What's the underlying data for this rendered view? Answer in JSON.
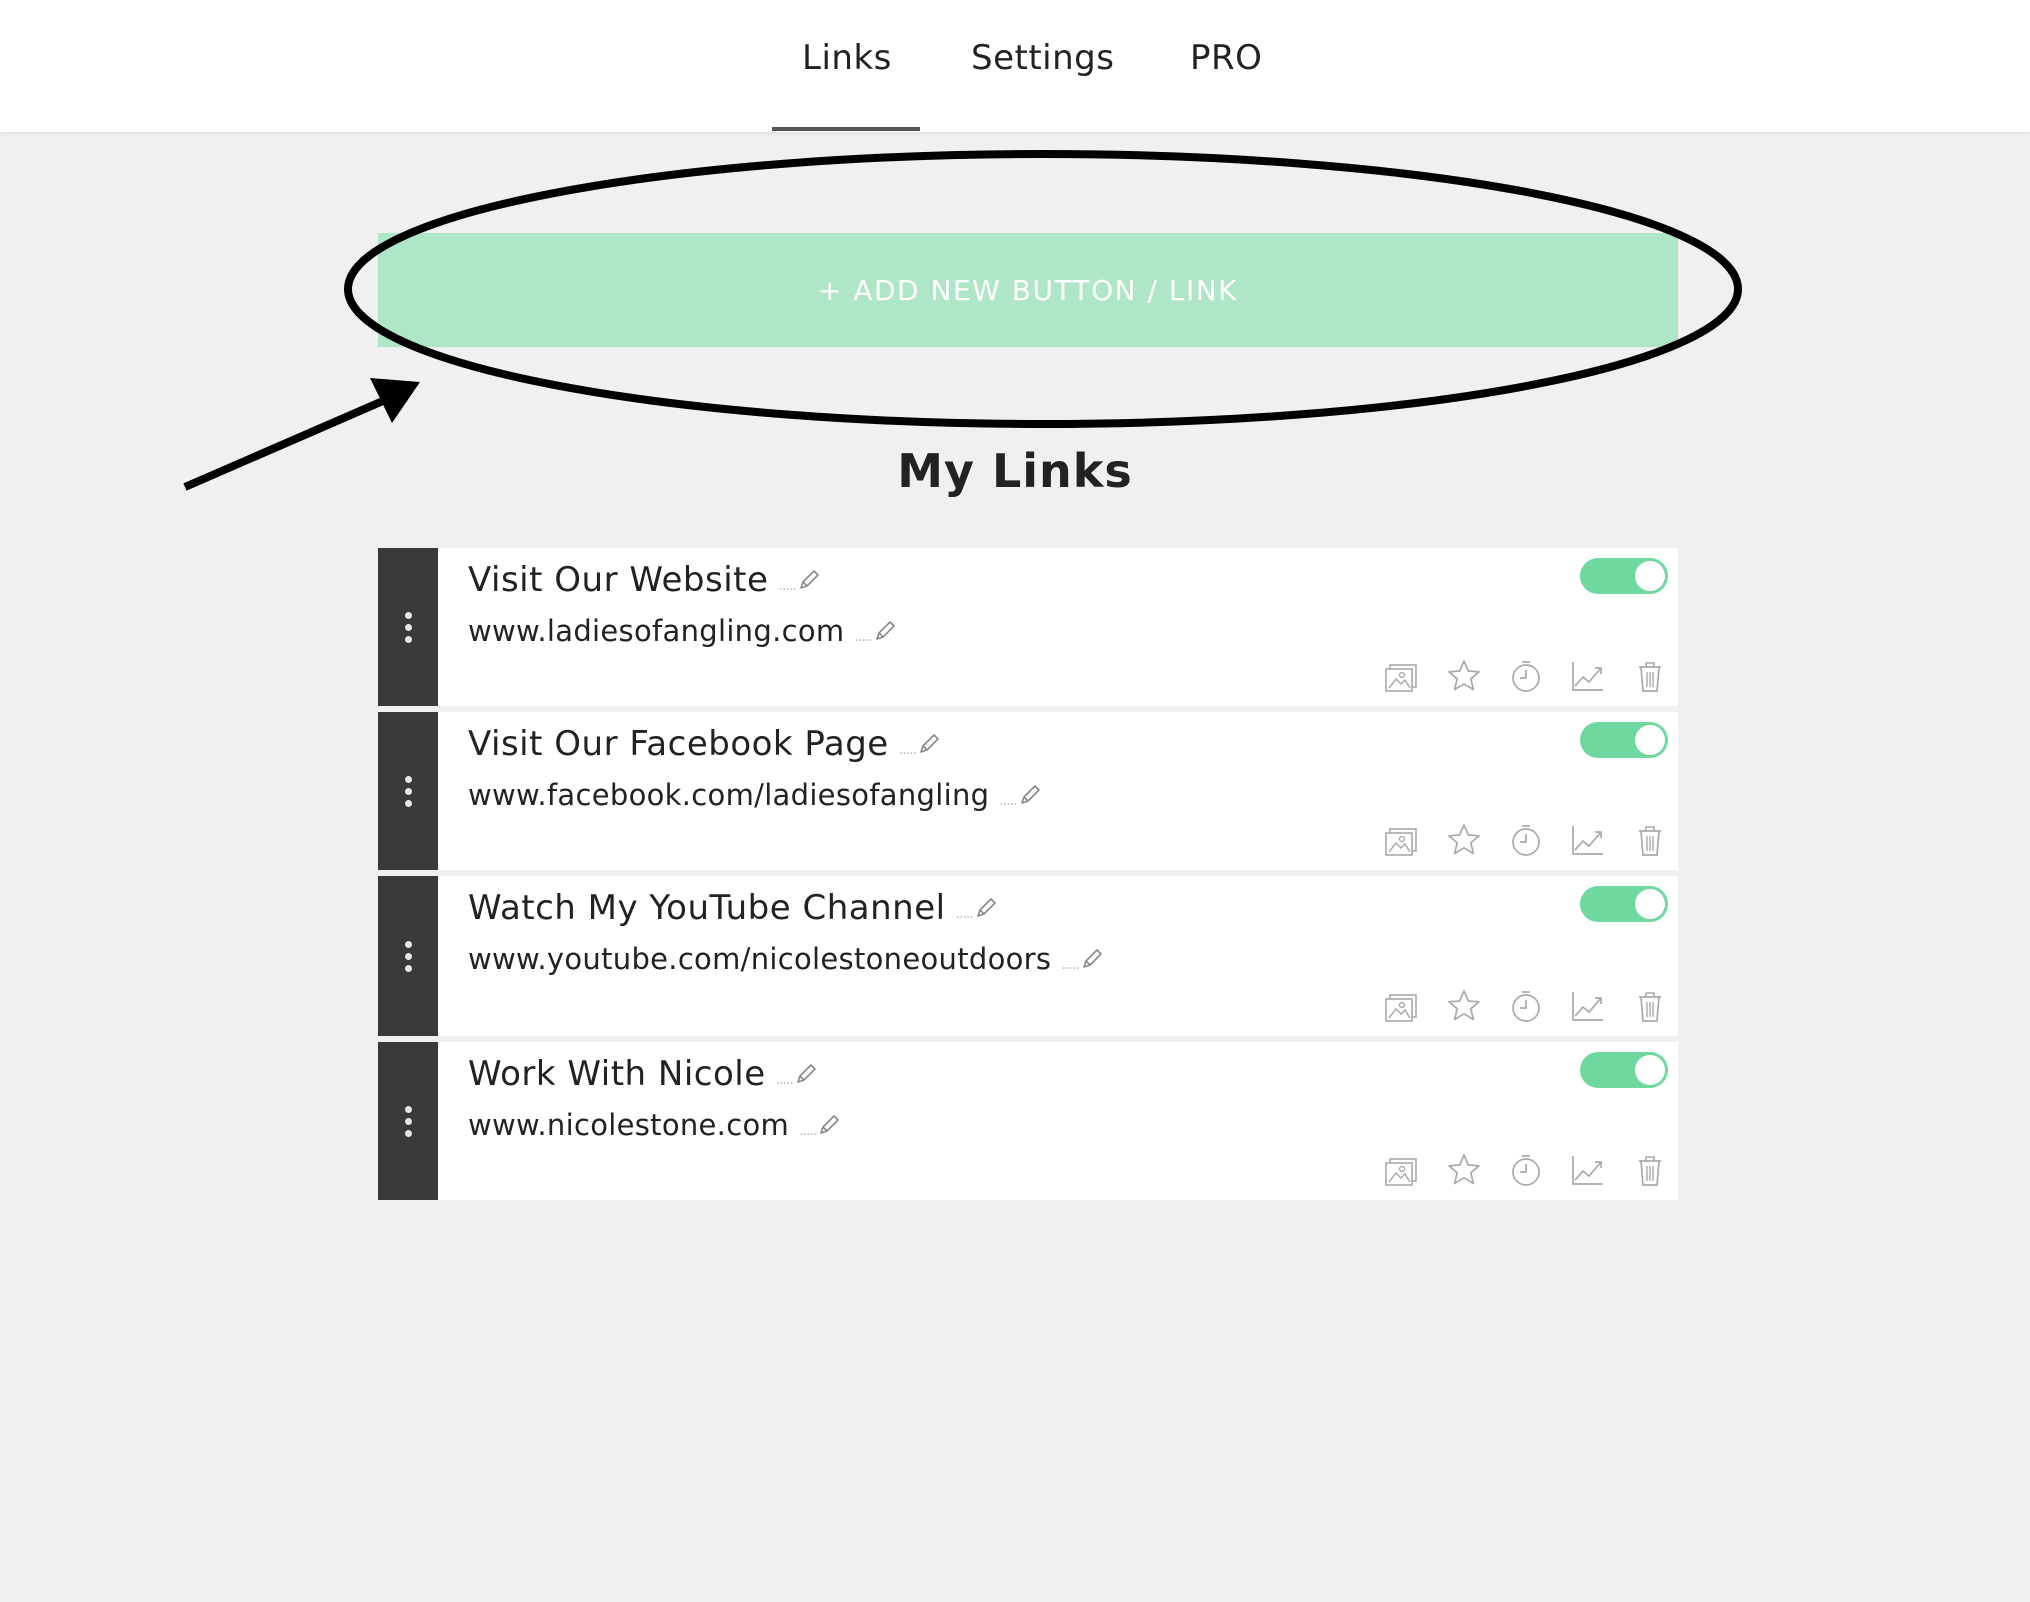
{
  "nav": {
    "tabs": [
      {
        "label": "Links",
        "active": true
      },
      {
        "label": "Settings",
        "active": false
      },
      {
        "label": "PRO",
        "active": false
      }
    ]
  },
  "add_button": {
    "label": "+ ADD NEW BUTTON / LINK"
  },
  "section_title": "My Links",
  "links": [
    {
      "title": "Visit Our Website",
      "url": "www.ladiesofangling.com",
      "enabled": true
    },
    {
      "title": "Visit Our Facebook Page",
      "url": "www.facebook.com/ladiesofangling",
      "enabled": true
    },
    {
      "title": "Watch My YouTube Channel",
      "url": "www.youtube.com/nicolestoneoutdoors",
      "enabled": true
    },
    {
      "title": "Work With Nicole",
      "url": "www.nicolestone.com",
      "enabled": true
    }
  ],
  "card_actions": [
    "image-icon",
    "star-icon",
    "timer-icon",
    "analytics-icon",
    "trash-icon"
  ],
  "colors": {
    "accent_green": "#6ed89f",
    "add_button_bg": "#b0e6c8",
    "handle_bg": "#3a3a3a",
    "page_bg": "#f0f0f0",
    "annotation": "#000000"
  }
}
